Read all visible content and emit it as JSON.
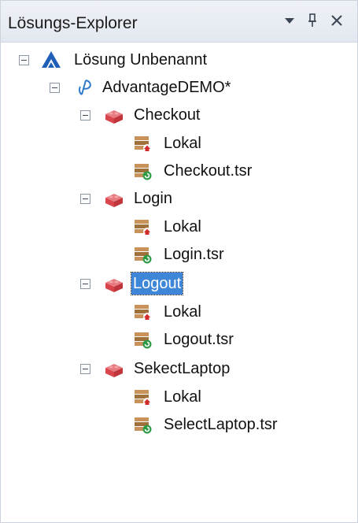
{
  "panel": {
    "title": "Lösungs-Explorer",
    "buttons": [
      "dropdown-icon",
      "pin-icon",
      "close-icon"
    ]
  },
  "tree": {
    "solution": "Lösung Unbenannt",
    "project": "AdvantageDEMO*",
    "tests": [
      {
        "name": "Checkout",
        "items": [
          "Lokal",
          "Checkout.tsr"
        ]
      },
      {
        "name": "Login",
        "items": [
          "Lokal",
          "Login.tsr"
        ]
      },
      {
        "name": "Logout",
        "items": [
          "Lokal",
          "Logout.tsr"
        ],
        "selected": true
      },
      {
        "name": "SekectLaptop",
        "items": [
          "Lokal",
          "SelectLaptop.tsr"
        ]
      }
    ]
  },
  "colors": {
    "selection": "#3d86d8",
    "titlebar": "#e6eaf1",
    "test_icon": "#d9454d",
    "repo_icon": "#a0703a"
  }
}
